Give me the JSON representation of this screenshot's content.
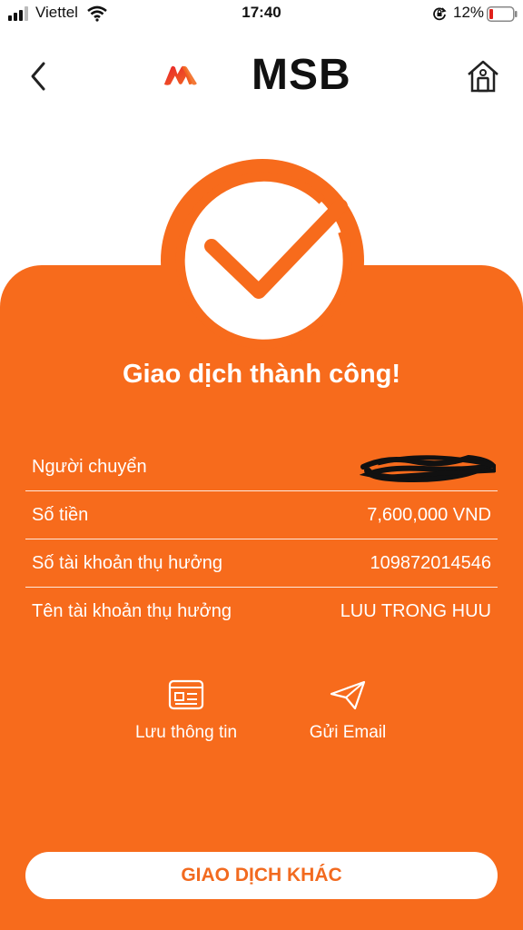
{
  "status_bar": {
    "carrier": "Viettel",
    "time": "17:40",
    "battery": "12%"
  },
  "header": {
    "logo_text": "MSB"
  },
  "result": {
    "title": "Giao dịch thành công!"
  },
  "details": [
    {
      "label": "Người chuyển",
      "value": ""
    },
    {
      "label": "Số tiền",
      "value": "7,600,000 VND"
    },
    {
      "label": "Số tài khoản thụ hưởng",
      "value": "109872014546"
    },
    {
      "label": "Tên tài khoản thụ hưởng",
      "value": "LUU TRONG HUU"
    }
  ],
  "actions": {
    "save_label": "Lưu thông tin",
    "email_label": "Gửi Email"
  },
  "bottom_button": {
    "label": "GIAO DỊCH KHÁC"
  },
  "icons": {
    "back": "chevron-left-icon",
    "home": "home-icon",
    "save": "id-card-icon",
    "email": "paper-plane-icon",
    "success": "check-circle-icon"
  },
  "colors": {
    "accent": "#f76b1c",
    "button_text": "#f26a1f"
  }
}
